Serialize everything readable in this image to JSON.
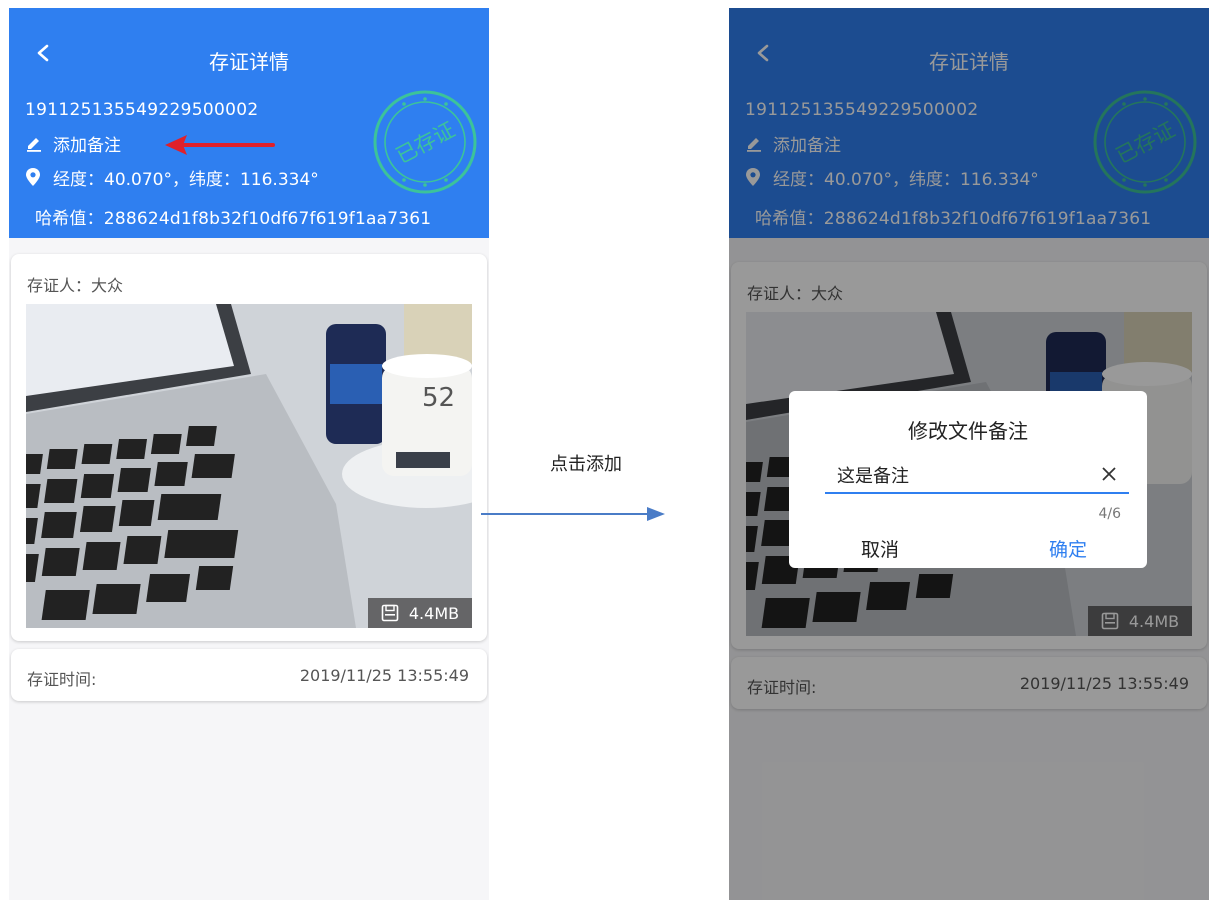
{
  "left": {
    "header": {
      "title": "存证详情",
      "doc_id": "19112513554922950​0002",
      "remark_label": "添加备注",
      "location": "经度：40.070°，纬度：116.334°",
      "hash": "哈希值：288624d1f8b32f10df67f619f1aa7361",
      "seal_text": "已存证"
    },
    "card": {
      "depositor": "存证人：大众",
      "file_size": "4.4MB"
    },
    "time": {
      "label": "存证时间:",
      "value": "2019/11/25  13:55:49"
    }
  },
  "right": {
    "header": {
      "title": "存证详情",
      "doc_id": "191125135549229500002",
      "remark_label": "添加备注",
      "location": "经度：40.070°，纬度：116.334°",
      "hash": "哈希值：288624d1f8b32f10df67f619f1aa7361",
      "seal_text": "已存证"
    },
    "card": {
      "depositor": "存证人：大众",
      "file_size": "4.4MB"
    },
    "time": {
      "label": "存证时间:",
      "value": "2019/11/25  13:55:49"
    },
    "dialog": {
      "title": "修改文件备注",
      "input_value": "这是备注",
      "counter": "4/6",
      "cancel": "取消",
      "confirm": "确定"
    }
  },
  "caption": "点击添加",
  "colors": {
    "header_blue": "#2f7ff0",
    "seal_green": "#3cc39a",
    "annotation_red": "#e0202a",
    "arrow_blue": "#4a7cc7"
  },
  "icons": [
    "back-icon",
    "edit-icon",
    "location-pin-icon",
    "save-disk-icon",
    "close-icon"
  ]
}
